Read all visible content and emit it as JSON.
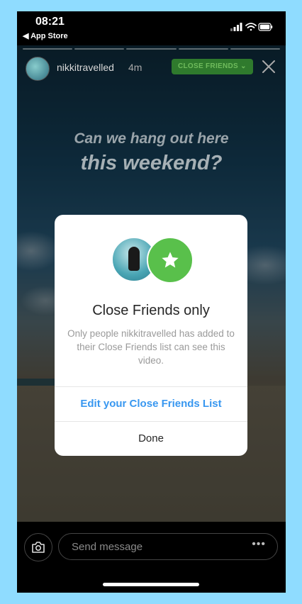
{
  "status_bar": {
    "time": "08:21",
    "back_label": "◀ App Store"
  },
  "story": {
    "username": "nikkitravelled",
    "age": "4m",
    "badge": "CLOSE FRIENDS ⌄",
    "badge_color": "#2f7a2d",
    "headline_line1": "Can we hang out here",
    "headline_line2": "this weekend?"
  },
  "dialog": {
    "title": "Close Friends only",
    "body": "Only people nikkitravelled has added to their Close Friends list can see this video.",
    "edit_label": "Edit your Close Friends List",
    "done_label": "Done",
    "accent_color": "#3897f0",
    "star_color": "#59c04b"
  },
  "reply": {
    "placeholder": "Send message",
    "more": "•••"
  }
}
